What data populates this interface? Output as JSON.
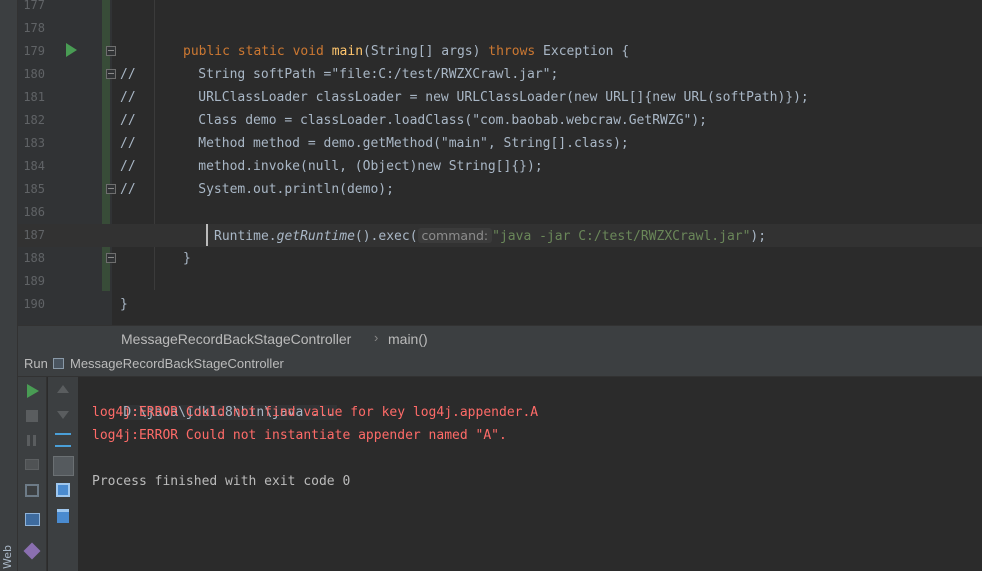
{
  "sidebar": {
    "web_label": "Web"
  },
  "editor": {
    "lines": [
      {
        "num": "177"
      },
      {
        "num": "178"
      },
      {
        "num": "179"
      },
      {
        "num": "180"
      },
      {
        "num": "181"
      },
      {
        "num": "182"
      },
      {
        "num": "183"
      },
      {
        "num": "184"
      },
      {
        "num": "185"
      },
      {
        "num": "186"
      },
      {
        "num": "187"
      },
      {
        "num": "188"
      },
      {
        "num": "189"
      },
      {
        "num": "190"
      }
    ],
    "code": {
      "l179_a": "public static void ",
      "l179_fn": "main",
      "l179_b": "(String[] args) ",
      "l179_kw": "throws",
      "l179_c": " Exception {",
      "l180": "//        String softPath =\"file:C:/test/RWZXCrawl.jar\";",
      "l181": "//        URLClassLoader classLoader = new URLClassLoader(new URL[]{new URL(softPath)});",
      "l182": "//        Class demo = classLoader.loadClass(\"com.baobab.webcraw.GetRWZG\");",
      "l183": "//        Method method = demo.getMethod(\"main\", String[].class);",
      "l184": "//        method.invoke(null, (Object)new String[]{});",
      "l185": "//        System.out.println(demo);",
      "l187_a": "Runtime.",
      "l187_fn": "getRuntime",
      "l187_b": "().exec(",
      "l187_hint": "command:",
      "l187_str": "\"java -jar C:/test/RWZXCrawl.jar\"",
      "l187_c": ");",
      "l188": "}",
      "l190": "}"
    }
  },
  "breadcrumb": {
    "class_name": "MessageRecordBackStageController",
    "separator": "›",
    "method": "main()"
  },
  "run_panel": {
    "label": "Run",
    "config_name": "MessageRecordBackStageController"
  },
  "console": {
    "command": "D:\\java\\jdk1.8\\bin\\java ...",
    "errors": [
      "log4j:ERROR Could not find value for key log4j.appender.A",
      "log4j:ERROR Could not instantiate appender named \"A\"."
    ],
    "exit_message": "Process finished with exit code 0"
  },
  "colors": {
    "keyword": "#cc7832",
    "function": "#ffc66d",
    "comment": "#808080",
    "string": "#6a8759",
    "error": "#ff6b68",
    "run_green": "#499c54"
  }
}
